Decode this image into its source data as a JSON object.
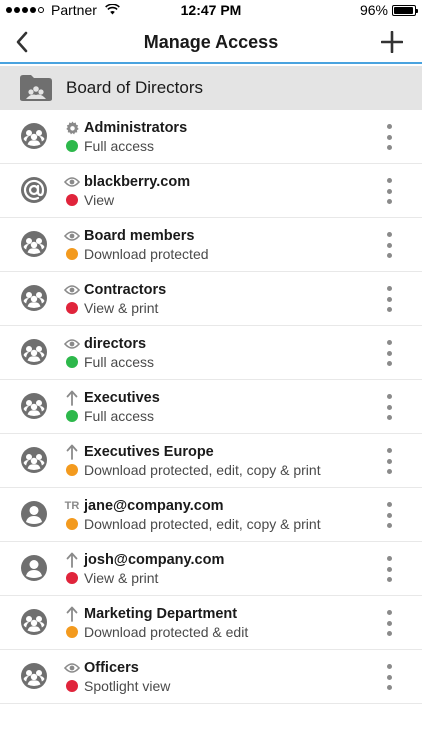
{
  "status_bar": {
    "carrier": "Partner",
    "time": "12:47 PM",
    "battery": "96%",
    "battery_level": 0.96
  },
  "nav": {
    "title": "Manage Access",
    "back_icon": "chevron-left-icon",
    "add_icon": "plus-icon"
  },
  "folder": {
    "name": "Board of Directors",
    "icon": "folder-shared-icon"
  },
  "colors": {
    "accent": "#4aa3df",
    "full": "#2db84b",
    "protected": "#f39a1e",
    "restricted": "#e0243b"
  },
  "entries": [
    {
      "name": "Administrators",
      "permission": "Full access",
      "avatar": "group",
      "type_icon": "gear",
      "status": "green"
    },
    {
      "name": "blackberry.com",
      "permission": "View",
      "avatar": "domain",
      "type_icon": "eye",
      "status": "red"
    },
    {
      "name": "Board members",
      "permission": "Download protected",
      "avatar": "group",
      "type_icon": "eye",
      "status": "orange"
    },
    {
      "name": "Contractors",
      "permission": "View & print",
      "avatar": "group",
      "type_icon": "eye",
      "status": "red"
    },
    {
      "name": "directors",
      "permission": "Full access",
      "avatar": "group",
      "type_icon": "eye",
      "status": "green"
    },
    {
      "name": "Executives",
      "permission": "Full access",
      "avatar": "group",
      "type_icon": "arrow-up",
      "status": "green"
    },
    {
      "name": "Executives Europe",
      "permission": "Download protected, edit, copy & print",
      "avatar": "group",
      "type_icon": "arrow-up",
      "status": "orange"
    },
    {
      "name": "jane@company.com",
      "permission": "Download protected, edit, copy & print",
      "avatar": "person",
      "type_icon": "tr",
      "type_text": "TR",
      "status": "orange"
    },
    {
      "name": "josh@company.com",
      "permission": "View & print",
      "avatar": "person",
      "type_icon": "arrow-up",
      "status": "red"
    },
    {
      "name": "Marketing Department",
      "permission": "Download protected & edit",
      "avatar": "group",
      "type_icon": "arrow-up",
      "status": "orange"
    },
    {
      "name": "Officers",
      "permission": "Spotlight view",
      "avatar": "group",
      "type_icon": "eye",
      "status": "red"
    }
  ]
}
